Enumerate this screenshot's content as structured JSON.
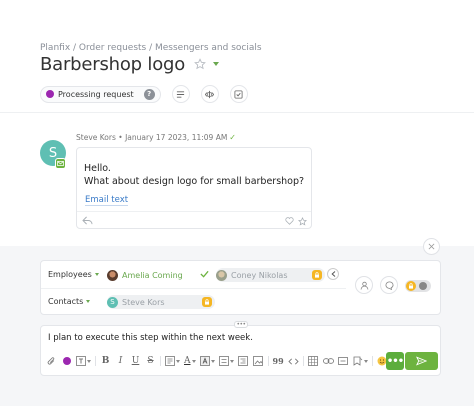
{
  "breadcrumb": "Planfix / Order requests / Messengers and socials",
  "task": {
    "title": "Barbershop logo",
    "status": "Processing request",
    "status_color": "#9c27b0",
    "help_label": "?"
  },
  "toolbar_icons": [
    "list-icon",
    "split-icon",
    "checklist-icon"
  ],
  "message": {
    "author_initial": "S",
    "author": "Steve Kors",
    "datetime": "January 17 2023, 11:09 AM",
    "lines": [
      "Hello.",
      "What about design logo for small barbershop?"
    ],
    "link": "Email text"
  },
  "participants": {
    "employees_label": "Employees",
    "contacts_label": "Contacts",
    "employees": [
      {
        "name": "Amelia Coming",
        "state": "active"
      },
      {
        "name": "Coney Nikolas",
        "state": "disabled"
      }
    ],
    "contacts": [
      {
        "name": "Steve Kors",
        "initial": "S",
        "state": "disabled"
      }
    ]
  },
  "editor": {
    "text": "I plan to execute this step within the next week.",
    "format_buttons": [
      "attach-icon",
      "color-dot",
      "text-style",
      "bold",
      "italic",
      "underline",
      "strikethrough",
      "paragraph",
      "font-color",
      "highlight",
      "list",
      "indent",
      "image",
      "quote",
      "code",
      "table",
      "link",
      "anchor",
      "bookmark",
      "emoji",
      "case"
    ],
    "bold_label": "B",
    "italic_label": "I",
    "underline_label": "U",
    "strike_label": "S",
    "quote_label": "99",
    "case_label": "Aa",
    "font_letter": "A",
    "more_label": "•••"
  },
  "colors": {
    "accent_green": "#6db33f",
    "status_purple": "#9c27b0",
    "lock_yellow": "#f5b623",
    "link_blue": "#3a7bc8"
  }
}
